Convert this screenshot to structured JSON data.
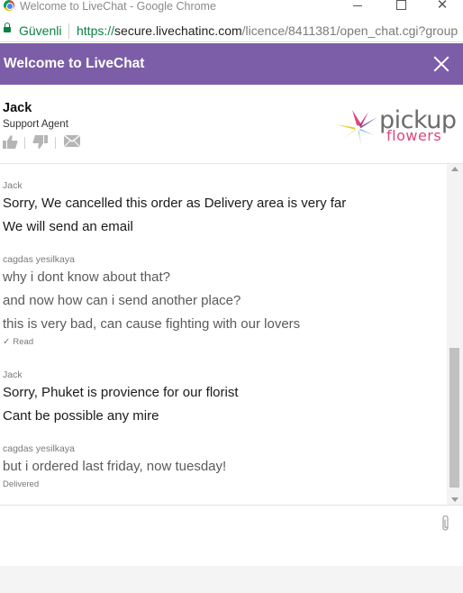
{
  "window": {
    "title": "Welcome to LiveChat - Google Chrome",
    "icons": [
      "chrome-icon",
      "minimize-icon",
      "maximize-icon",
      "close-window-icon"
    ]
  },
  "addressbar": {
    "secure_label": "Güvenli",
    "url_scheme": "https://",
    "url_host": "secure.livechatinc.com",
    "url_path": "/licence/8411381/open_chat.cgi?group",
    "secure_color": "#0b8043"
  },
  "header": {
    "title": "Welcome to LiveChat",
    "bg_color": "#7b5ea7"
  },
  "agent": {
    "name": "Jack",
    "role": "Support Agent",
    "rating_icons": [
      "thumbs-up-icon",
      "thumbs-down-icon",
      "email-icon"
    ]
  },
  "brand": {
    "word1": "pickup",
    "word2": "flowers",
    "accent_color": "#e0457a"
  },
  "messages": [
    {
      "author": "Jack",
      "lines": [
        "Sorry, We cancelled this order as Delivery area is very far",
        "We will send an email"
      ],
      "status": ""
    },
    {
      "author": "cagdas yesilkaya",
      "lines": [
        "why i dont know about that?",
        "and now how can i send another place?",
        "this is very bad, can cause fighting with our lovers"
      ],
      "status": "Read"
    },
    {
      "author": "Jack",
      "lines": [
        "Sorry, Phuket is provience for our florist",
        "Cant be possible any mire"
      ],
      "status": ""
    },
    {
      "author": "cagdas yesilkaya",
      "lines": [
        "but i ordered last friday, now tuesday!"
      ],
      "status": "Delivered"
    }
  ],
  "composer": {
    "placeholder": "",
    "value": "",
    "attach_icon": "paperclip-icon"
  }
}
